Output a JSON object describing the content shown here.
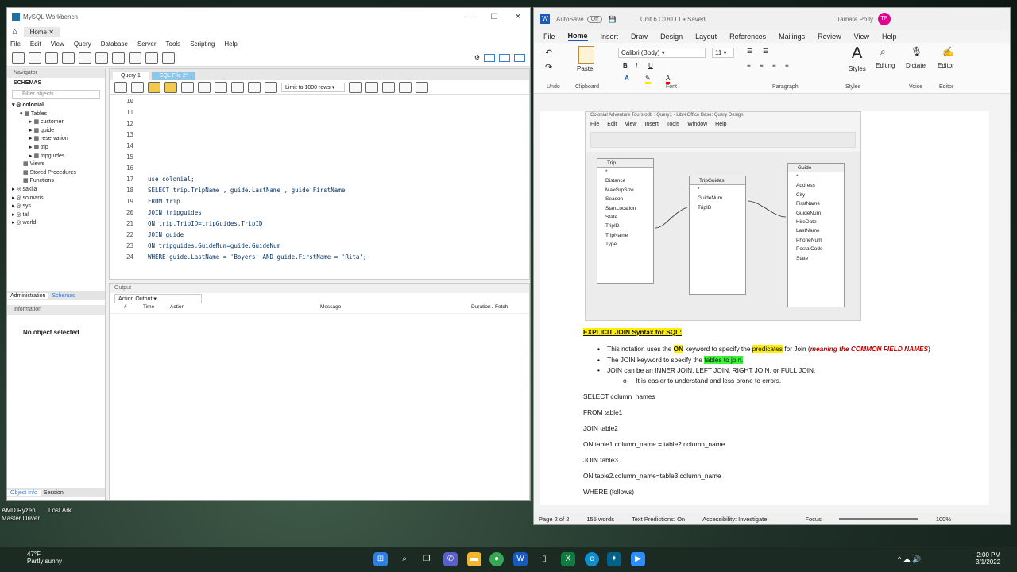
{
  "desktop": {
    "icons": [
      {
        "label": "AMD Ryzen Master Driver"
      },
      {
        "label": "Lost Ark"
      }
    ],
    "weather": {
      "temp": "47°F",
      "desc": "Partly sunny"
    },
    "clock": {
      "time": "2:00 PM",
      "date": "3/1/2022"
    }
  },
  "workbench": {
    "title": "MySQL Workbench",
    "home_tab": "Home",
    "menu": [
      "File",
      "Edit",
      "View",
      "Query",
      "Database",
      "Server",
      "Tools",
      "Scripting",
      "Help"
    ],
    "navigator_label": "Navigator",
    "schemas_label": "SCHEMAS",
    "filter_placeholder": "Filter objects",
    "tree": {
      "db": "colonial",
      "tables": "Tables",
      "table_items": [
        "customer",
        "guide",
        "reservation",
        "trip",
        "tripguides"
      ],
      "views": "Views",
      "procs": "Stored Procedures",
      "funcs": "Functions",
      "others": [
        "sakila",
        "solmaris",
        "sys",
        "tal",
        "world"
      ]
    },
    "admin_tab": "Administration",
    "schemas_tab": "Schemas",
    "info_label": "Information",
    "no_object": "No object selected",
    "object_info_tab": "Object Info",
    "session_tab": "Session",
    "query_tab": "Query 1",
    "sql_tab": "SQL File 2*",
    "limit": "Limit to 1000 rows",
    "code": [
      {
        "n": "10",
        "t": ""
      },
      {
        "n": "11",
        "t": ""
      },
      {
        "n": "12",
        "t": ""
      },
      {
        "n": "13",
        "t": ""
      },
      {
        "n": "14",
        "t": ""
      },
      {
        "n": "15",
        "t": ""
      },
      {
        "n": "16",
        "t": ""
      },
      {
        "n": "17",
        "t": "use colonial;"
      },
      {
        "n": "18",
        "t": "SELECT trip.TripName , guide.LastName , guide.FirstName"
      },
      {
        "n": "19",
        "t": "FROM trip"
      },
      {
        "n": "20",
        "t": "JOIN tripguides"
      },
      {
        "n": "21",
        "t": "ON trip.TripID=tripGuides.TripID"
      },
      {
        "n": "22",
        "t": "JOIN guide"
      },
      {
        "n": "23",
        "t": "ON tripguides.GuideNum=guide.GuideNum"
      },
      {
        "n": "24",
        "t": "WHERE guide.LastName = 'Boyers' AND guide.FirstName = 'Rita';"
      }
    ],
    "output_label": "Output",
    "output_select": "Action Output",
    "output_cols": [
      "#",
      "Time",
      "Action",
      "Message",
      "Duration / Fetch"
    ]
  },
  "word": {
    "autosave": "AutoSave",
    "toggle": "Off",
    "doc_title": "Unit 6 C181TT • Saved",
    "user": "Tamate Polly",
    "avatar": "TP",
    "menu": [
      "File",
      "Home",
      "Insert",
      "Draw",
      "Design",
      "Layout",
      "References",
      "Mailings",
      "Review",
      "View",
      "Help"
    ],
    "font": "Calibri (Body)",
    "size": "11",
    "groups": [
      "Undo",
      "Clipboard",
      "Font",
      "Paragraph",
      "Styles",
      "Voice",
      "Editor"
    ],
    "paste": "Paste",
    "styles": "Styles",
    "editing": "Editing",
    "dictate": "Dictate",
    "editor": "Editor",
    "embedded": {
      "title": "Colonial Adventure Tours.odb : Query1 - LibreOffice Base: Query Design",
      "menu": [
        "File",
        "Edit",
        "View",
        "Insert",
        "Tools",
        "Window",
        "Help"
      ],
      "tables": [
        {
          "name": "Trip",
          "fields": [
            "*",
            "Distance",
            "MaxGrpSize",
            "Season",
            "StartLocation",
            "State",
            "TripID",
            "TripName",
            "Type"
          ]
        },
        {
          "name": "TripGuides",
          "fields": [
            "*",
            "GuideNum",
            "TripID"
          ]
        },
        {
          "name": "Guide",
          "fields": [
            "*",
            "Address",
            "City",
            "FirstName",
            "GuideNum",
            "HireDate",
            "LastName",
            "PhoneNum",
            "PostalCode",
            "State"
          ]
        }
      ]
    },
    "heading": "EXPLICIT JOIN Syntax for SQL:",
    "bullet1": {
      "a": "This notation uses the ",
      "b": "ON",
      "c": " keyword to specify the ",
      "d": "predicates",
      "e": " for Join (",
      "f": "meaning the COMMON FIELD NAMES",
      "g": ")"
    },
    "bullet2": {
      "a": "The JOIN keyword to specify the ",
      "b": "tables to join."
    },
    "bullet3": "JOIN can be an INNER JOIN, LEFT JOIN, RIGHT JOIN, or FULL JOIN.",
    "sub": "It is easier to understand and less prone to errors.",
    "syntax": [
      "SELECT column_names",
      "FROM table1",
      "JOIN table2",
      "ON table1.column_name = table2.column_name",
      "JOIN table3",
      "ON table2.column_name=table3.column_name",
      "WHERE (follows)"
    ],
    "status": {
      "page": "Page 2 of 2",
      "words": "155 words",
      "pred": "Text Predictions: On",
      "acc": "Accessibility: Investigate",
      "focus": "Focus",
      "zoom": "100%"
    }
  }
}
